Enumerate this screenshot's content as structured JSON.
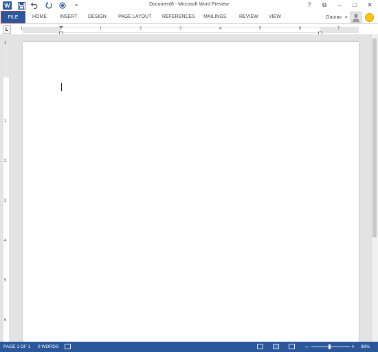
{
  "window": {
    "title": "Document8 - Microsoft Word Preview",
    "controls": [
      "?",
      "⧉",
      "–",
      "□",
      "✕"
    ]
  },
  "qat": {
    "app_icon": "W",
    "save_icon": "save-icon",
    "undo_icon": "undo-icon",
    "redo_icon": "redo-icon",
    "touch_icon": "touch-mode-icon",
    "customize_icon": "customize-qat-icon"
  },
  "ribbon": {
    "file_label": "FILE",
    "tabs": [
      "HOME",
      "INSERT",
      "DESIGN",
      "PAGE LAYOUT",
      "REFERENCES",
      "MAILINGS",
      "REVIEW",
      "VIEW"
    ]
  },
  "user": {
    "name": "Gaurav"
  },
  "ruler": {
    "tab_selector": "L",
    "h_numbers": [
      "1",
      "1",
      "2",
      "3",
      "4",
      "5",
      "6",
      "7"
    ],
    "v_numbers": [
      "1",
      "1",
      "2",
      "3",
      "4",
      "5",
      "6"
    ]
  },
  "status": {
    "page": "PAGE 1 OF 1",
    "words": "0 WORDS",
    "zoom_minus": "–",
    "zoom_plus": "+",
    "zoom": "98%"
  },
  "colors": {
    "accent": "#2b579a",
    "file_outline": "#c0304a"
  }
}
